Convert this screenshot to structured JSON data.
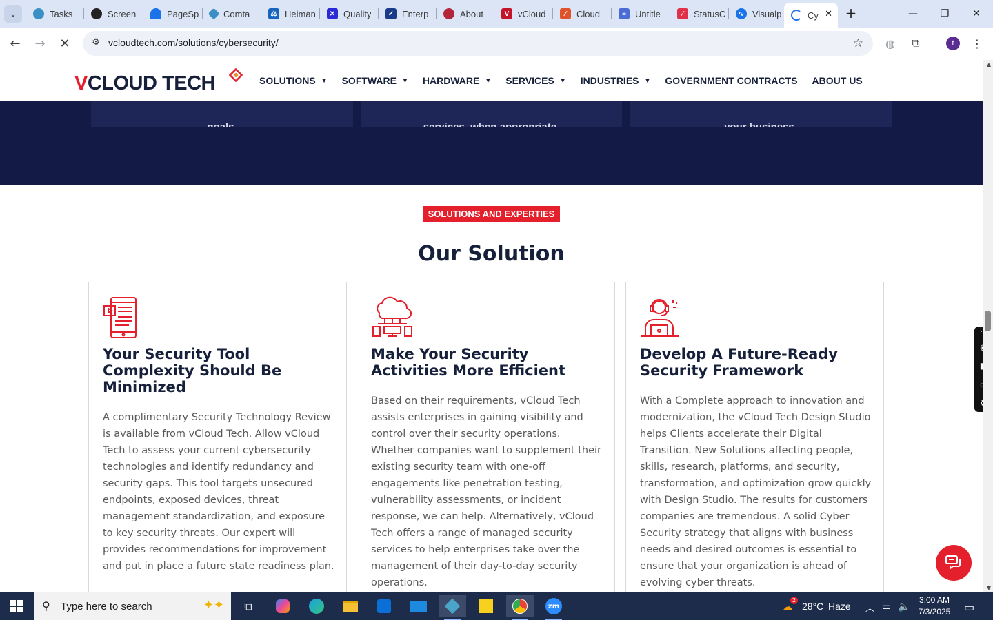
{
  "browser": {
    "tabs": [
      {
        "title": "Tasks",
        "color": "#3a8fc4"
      },
      {
        "title": "Screen",
        "color": "#222222"
      },
      {
        "title": "PageSp",
        "color": "#1a73e8"
      },
      {
        "title": "Comta",
        "color": "#3a8fc4"
      },
      {
        "title": "Heiman",
        "color": "#1565c0"
      },
      {
        "title": "Quality",
        "color": "#2a2ad6"
      },
      {
        "title": "Enterp",
        "color": "#1a3a8a"
      },
      {
        "title": "About",
        "color": "#b3263a"
      },
      {
        "title": "vCloud",
        "color": "#c4142a"
      },
      {
        "title": "Cloud",
        "color": "#e0522a"
      },
      {
        "title": "Untitle",
        "color": "#4a6cd4"
      },
      {
        "title": "StatusC",
        "color": "#e0304a"
      },
      {
        "title": "Visualp",
        "color": "#1a73e8"
      },
      {
        "title": "Cy",
        "color": "#1a73e8"
      }
    ],
    "url": "vcloudtech.com/solutions/cybersecurity/",
    "profile_initial": "t"
  },
  "site": {
    "logo": {
      "part1": "V",
      "part2": "CLOUD",
      "part3": " TECH"
    },
    "nav": [
      "SOLUTIONS",
      "SOFTWARE",
      "HARDWARE",
      "SERVICES",
      "INDUSTRIES",
      "GOVERNMENT CONTRACTS",
      "ABOUT US"
    ],
    "dark_cards": [
      "goals.",
      "services, when appropriate.",
      "your business."
    ],
    "tag": "SOLUTIONS AND EXPERTIES",
    "section_title": "Our Solution",
    "cards": [
      {
        "icon": "monitor-document-icon",
        "title": "Your Security Tool Complexity Should Be Minimized",
        "body": "A complimentary Security Technology Review is available from vCloud Tech. Allow vCloud Tech to assess your current cybersecurity technologies and identify redundancy and security gaps. This tool targets unsecured endpoints, exposed devices, threat management standardization, and exposure to key security threats. Our expert will provides recommendations for improvement and put in place a future state readiness plan."
      },
      {
        "icon": "cloud-network-icon",
        "title": "Make Your Security Activities More Efficient",
        "body": "Based on their requirements, vCloud Tech assists enterprises in gaining visibility and control over their security operations. Whether companies want to supplement their existing security team with one-off engagements like penetration testing, vulnerability assessments, or incident response, we can help. Alternatively, vCloud Tech offers a range of managed security services to help enterprises take over the management of their day-to-day security operations."
      },
      {
        "icon": "support-agent-icon",
        "title": "Develop A Future-Ready Security Framework",
        "body": "With a Complete approach to innovation and modernization, the vCloud Tech Design Studio helps Clients accelerate their Digital Transition. New Solutions affecting people, skills, research, platforms, and security, transformation, and optimization grow quickly with Design Studio. The results for customers companies are tremendous. A solid Cyber Security strategy that aligns with business needs and desired outcomes is essential to ensure that your organization is ahead of evolving cyber threats."
      }
    ]
  },
  "taskbar": {
    "search_placeholder": "Type here to search",
    "weather_temp": "28°C",
    "weather_desc": "Haze",
    "weather_badge": "2",
    "time": "3:00 AM",
    "date": "7/3/2025"
  },
  "colors": {
    "brand_red": "#e3202b",
    "navy": "#16203a",
    "dark_band": "#131a45"
  }
}
